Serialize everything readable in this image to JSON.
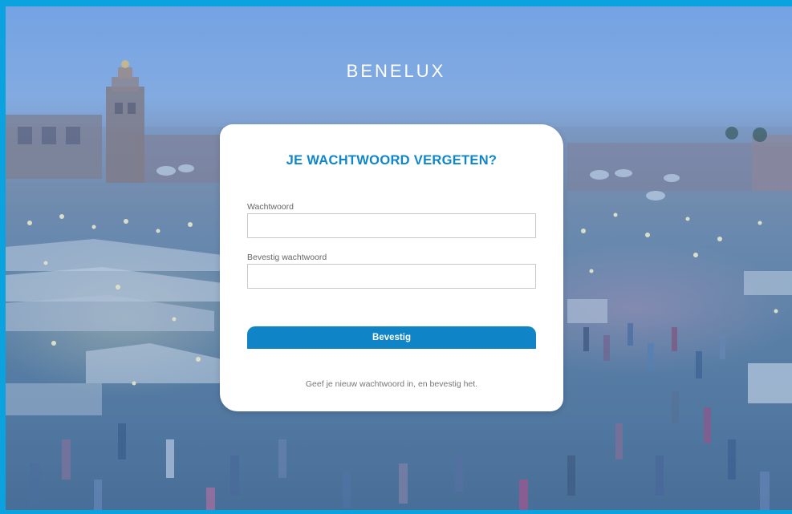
{
  "brand": {
    "name": "BENELUX"
  },
  "form": {
    "title": "JE WACHTWOORD VERGETEN?",
    "password_label": "Wachtwoord",
    "password_value": "",
    "confirm_label": "Bevestig wachtwoord",
    "confirm_value": "",
    "submit_label": "Bevestig",
    "hint": "Geef je nieuw wachtwoord in, en bevestig het."
  },
  "colors": {
    "frame": "#0aa3e0",
    "accent": "#0f86c9",
    "button": "#0f84c6"
  }
}
